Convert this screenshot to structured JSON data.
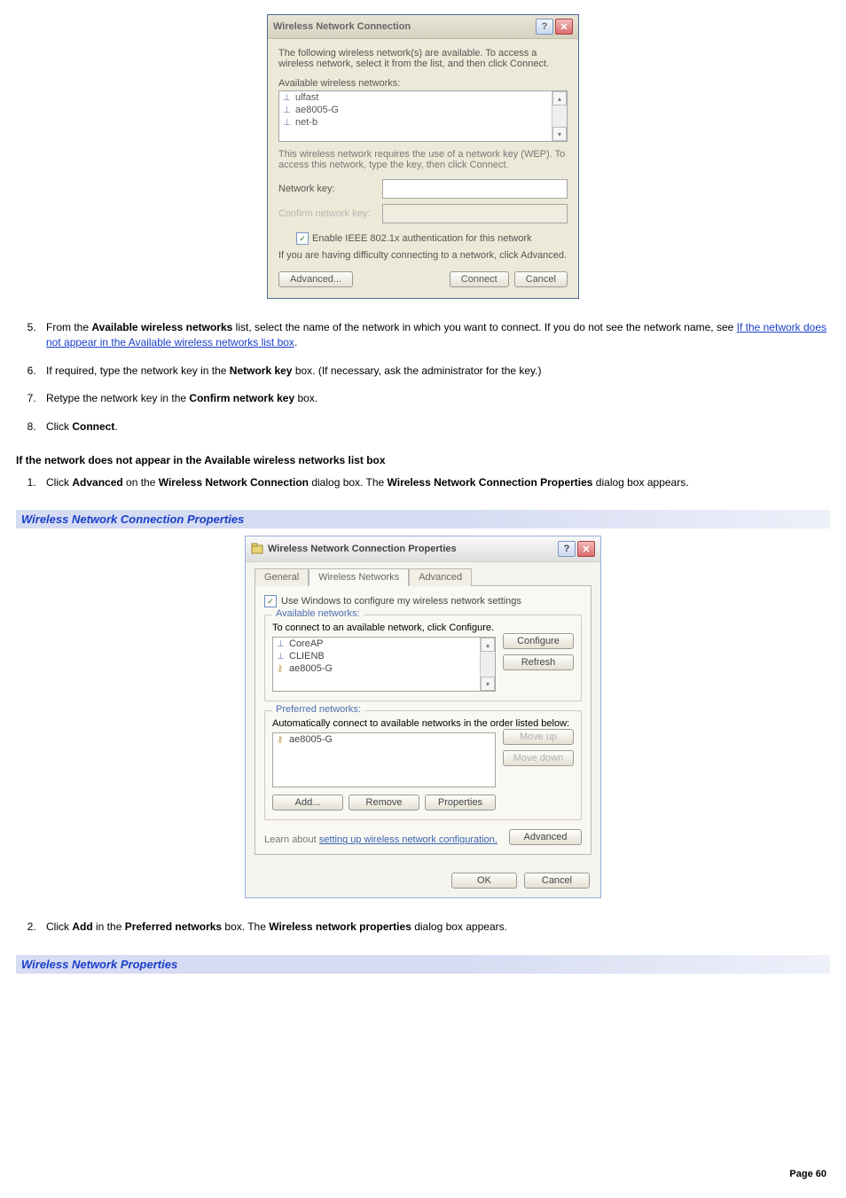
{
  "dialog1": {
    "title": "Wireless Network Connection",
    "intro": "The following wireless network(s) are available. To access a wireless network, select it from the list, and then click Connect.",
    "list_label": "Available wireless networks:",
    "items": [
      "ulfast",
      "ae8005-G",
      "net-b"
    ],
    "wep_text": "This wireless network requires the use of a network key (WEP). To access this network, type the key, then click Connect.",
    "netkey_label": "Network key:",
    "confirm_label": "Confirm network key:",
    "chk_label": "Enable IEEE 802.1x authentication for this network",
    "diff_text": "If you are having difficulty connecting to a network, click Advanced.",
    "btn_advanced": "Advanced...",
    "btn_connect": "Connect",
    "btn_cancel": "Cancel"
  },
  "steps1": {
    "s5a": "From the ",
    "s5b": "Available wireless networks",
    "s5c": " list, select the name of the network in which you want to connect. If you do not see the network name, see ",
    "s5link": "If the network does not appear in the Available wireless networks list box",
    "s5d": ".",
    "s6a": "If required, type the network key in the ",
    "s6b": "Network key",
    "s6c": " box. (If necessary, ask the administrator for the key.)",
    "s7a": "Retype the network key in the ",
    "s7b": "Confirm network key",
    "s7c": " box.",
    "s8a": "Click ",
    "s8b": "Connect",
    "s8c": "."
  },
  "subhead1": "If the network does not appear in the Available wireless networks list box",
  "steps2": {
    "s1a": "Click ",
    "s1b": "Advanced",
    "s1c": " on the ",
    "s1d": "Wireless Network Connection",
    "s1e": " dialog box. The ",
    "s1f": "Wireless Network Connection Properties",
    "s1g": " dialog box appears."
  },
  "caption1": "Wireless Network Connection Properties",
  "dialog2": {
    "title": "Wireless Network Connection Properties",
    "tabs": {
      "general": "General",
      "wireless": "Wireless Networks",
      "advanced": "Advanced"
    },
    "use_windows": "Use Windows to configure my wireless network settings",
    "avail_legend": "Available networks:",
    "avail_help": "To connect to an available network, click Configure.",
    "avail_items": [
      "CoreAP",
      "CLIENB",
      "ae8005-G"
    ],
    "btn_configure": "Configure",
    "btn_refresh": "Refresh",
    "pref_legend": "Preferred networks:",
    "pref_help": "Automatically connect to available networks in the order listed below:",
    "pref_items": [
      "ae8005-G"
    ],
    "btn_moveup": "Move up",
    "btn_movedown": "Move down",
    "btn_add": "Add...",
    "btn_remove": "Remove",
    "btn_properties": "Properties",
    "learn_a": "Learn about ",
    "learn_link": "setting up wireless network configuration.",
    "btn_advanced": "Advanced",
    "btn_ok": "OK",
    "btn_cancel": "Cancel"
  },
  "steps3": {
    "s2a": "Click ",
    "s2b": "Add",
    "s2c": " in the ",
    "s2d": "Preferred networks",
    "s2e": " box. The ",
    "s2f": "Wireless network properties",
    "s2g": " dialog box appears."
  },
  "caption2": "Wireless Network Properties",
  "page": "Page 60"
}
